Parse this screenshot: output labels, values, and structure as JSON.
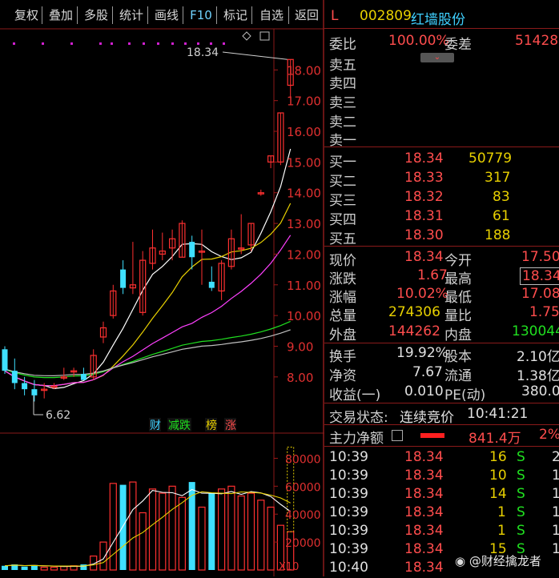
{
  "toolbar": {
    "items": [
      "复权",
      "叠加",
      "多股",
      "统计",
      "画线",
      "F10",
      "标记",
      "自选",
      "返回"
    ]
  },
  "stock": {
    "market": "L",
    "code": "002809",
    "name": "红墙股份"
  },
  "weibi": {
    "label": "委比",
    "value": "100.00%",
    "diff_label": "委差",
    "diff_value": "51428"
  },
  "sell": [
    {
      "label": "卖五"
    },
    {
      "label": "卖四"
    },
    {
      "label": "卖三"
    },
    {
      "label": "卖二"
    },
    {
      "label": "卖一"
    }
  ],
  "buy": [
    {
      "label": "买一",
      "price": "18.34",
      "vol": "50779"
    },
    {
      "label": "买二",
      "price": "18.33",
      "vol": "317"
    },
    {
      "label": "买三",
      "price": "18.32",
      "vol": "83"
    },
    {
      "label": "买四",
      "price": "18.31",
      "vol": "61"
    },
    {
      "label": "买五",
      "price": "18.30",
      "vol": "188"
    }
  ],
  "quote": [
    {
      "l1": "现价",
      "v1": "18.34",
      "l2": "今开",
      "v2": "17.50"
    },
    {
      "l1": "涨跌",
      "v1": "1.67",
      "l2": "最高",
      "v2": "18.34"
    },
    {
      "l1": "涨幅",
      "v1": "10.02%",
      "l2": "最低",
      "v2": "17.08"
    },
    {
      "l1": "总量",
      "v1": "274306",
      "l2": "量比",
      "v2": "1.75"
    },
    {
      "l1": "外盘",
      "v1": "144262",
      "l2": "内盘",
      "v2": "130044"
    }
  ],
  "fund": [
    {
      "l1": "换手",
      "v1": "19.92%",
      "l2": "股本",
      "v2": "2.10亿"
    },
    {
      "l1": "净资",
      "v1": "7.67",
      "l2": "流通",
      "v2": "1.38亿"
    },
    {
      "l1": "收益(一)",
      "v1": "0.010",
      "l2": "PE(动)",
      "v2": "380.0"
    }
  ],
  "trade_status": {
    "label": "交易状态:",
    "value": "连续竞价",
    "time": "10:41:21"
  },
  "main_flow": {
    "label": "主力净额",
    "value": "841.4万",
    "pct": "2%"
  },
  "ticks": [
    {
      "t": "10:39",
      "p": "18.34",
      "v": "16",
      "d": "S",
      "n": "2"
    },
    {
      "t": "10:39",
      "p": "18.34",
      "v": "10",
      "d": "S",
      "n": "1"
    },
    {
      "t": "10:39",
      "p": "18.34",
      "v": "14",
      "d": "S",
      "n": "1"
    },
    {
      "t": "10:39",
      "p": "18.34",
      "v": "1",
      "d": "S",
      "n": "1"
    },
    {
      "t": "10:39",
      "p": "18.34",
      "v": "1",
      "d": "S",
      "n": "1"
    },
    {
      "t": "10:39",
      "p": "18.34",
      "v": "15",
      "d": "S",
      "n": "1"
    },
    {
      "t": "10:40",
      "p": "18.34",
      "v": "",
      "d": "",
      "n": ""
    }
  ],
  "chart_data": {
    "type": "candlestick",
    "price_axis": [
      "18.00",
      "17.00",
      "16.00",
      "15.00",
      "14.00",
      "13.00",
      "12.00",
      "11.00",
      "10.00",
      "9.00",
      "8.00"
    ],
    "ylim": [
      7.5,
      18.4
    ],
    "high_label": "18.34",
    "low_label": "6.62",
    "tags": [
      "财",
      "减跌",
      "榜",
      "涨"
    ],
    "candles": [
      {
        "o": 8.9,
        "h": 9.0,
        "l": 8.1,
        "c": 8.2
      },
      {
        "o": 8.2,
        "h": 8.6,
        "l": 7.6,
        "c": 7.8
      },
      {
        "o": 7.8,
        "h": 8.0,
        "l": 7.4,
        "c": 7.6
      },
      {
        "o": 7.6,
        "h": 7.9,
        "l": 7.2,
        "c": 7.4
      },
      {
        "o": 7.6,
        "h": 7.8,
        "l": 7.3,
        "c": 7.6
      },
      {
        "o": 7.7,
        "h": 7.8,
        "l": 7.6,
        "c": 7.7
      },
      {
        "o": 8.0,
        "h": 8.3,
        "l": 7.9,
        "c": 8.0
      },
      {
        "o": 8.2,
        "h": 8.3,
        "l": 8.0,
        "c": 8.2
      },
      {
        "o": 8.1,
        "h": 8.3,
        "l": 7.9,
        "c": 7.9
      },
      {
        "o": 8.0,
        "h": 8.9,
        "l": 7.9,
        "c": 8.7
      },
      {
        "o": 9.3,
        "h": 9.8,
        "l": 9.1,
        "c": 9.6
      },
      {
        "o": 10.0,
        "h": 11.0,
        "l": 9.9,
        "c": 10.8
      },
      {
        "o": 11.5,
        "h": 11.8,
        "l": 10.7,
        "c": 10.9
      },
      {
        "o": 10.9,
        "h": 12.4,
        "l": 10.7,
        "c": 11.0
      },
      {
        "o": 10.1,
        "h": 12.1,
        "l": 10.0,
        "c": 11.8
      },
      {
        "o": 11.7,
        "h": 12.8,
        "l": 11.5,
        "c": 12.2
      },
      {
        "o": 12.0,
        "h": 12.7,
        "l": 11.8,
        "c": 12.1
      },
      {
        "o": 12.2,
        "h": 12.8,
        "l": 11.8,
        "c": 12.5
      },
      {
        "o": 11.9,
        "h": 13.1,
        "l": 11.9,
        "c": 13.0
      },
      {
        "o": 12.4,
        "h": 12.6,
        "l": 11.5,
        "c": 11.9
      },
      {
        "o": 12.1,
        "h": 12.8,
        "l": 11.0,
        "c": 12.1
      },
      {
        "o": 11.1,
        "h": 11.6,
        "l": 10.8,
        "c": 10.9
      },
      {
        "o": 10.8,
        "h": 11.8,
        "l": 10.5,
        "c": 11.7
      },
      {
        "o": 11.6,
        "h": 12.8,
        "l": 11.5,
        "c": 12.5
      },
      {
        "o": 12.2,
        "h": 13.3,
        "l": 12.0,
        "c": 12.2
      },
      {
        "o": 12.3,
        "h": 13.0,
        "l": 12.1,
        "c": 13.0
      },
      {
        "o": 14.0,
        "h": 14.1,
        "l": 13.9,
        "c": 14.0
      },
      {
        "o": 15.0,
        "h": 15.2,
        "l": 14.8,
        "c": 15.2
      },
      {
        "o": 15.0,
        "h": 16.6,
        "l": 14.9,
        "c": 16.6
      },
      {
        "o": 17.5,
        "h": 18.34,
        "l": 17.08,
        "c": 18.34
      }
    ],
    "volume_axis": [
      "80000",
      "60000",
      "40000",
      "20000"
    ],
    "volume_unit": "X10",
    "volume_max": 90000,
    "volumes": [
      3000,
      4000,
      2500,
      3500,
      2000,
      2000,
      2500,
      3000,
      4000,
      10000,
      20000,
      62000,
      61000,
      63000,
      41000,
      58000,
      55000,
      60000,
      52000,
      63000,
      45000,
      55000,
      58000,
      60000,
      53000,
      55000,
      50000,
      45000,
      32000,
      27430
    ]
  }
}
